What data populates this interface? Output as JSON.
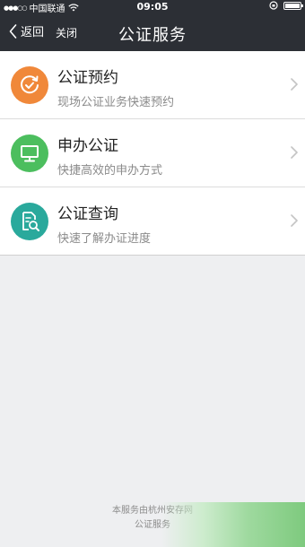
{
  "status": {
    "carrier": "中国联通",
    "time": "09:05"
  },
  "nav": {
    "back_label": "返回",
    "close_label": "关闭",
    "title": "公证服务"
  },
  "menu": [
    {
      "title": "公证预约",
      "subtitle": "现场公证业务快速预约",
      "icon": "clock-check-icon",
      "color": "#f0883a"
    },
    {
      "title": "申办公证",
      "subtitle": "快捷高效的申办方式",
      "icon": "monitor-icon",
      "color": "#4cbe5e"
    },
    {
      "title": "公证查询",
      "subtitle": "快速了解办证进度",
      "icon": "document-search-icon",
      "color": "#2aa99c"
    }
  ],
  "footer": {
    "line1": "本服务由杭州安存网",
    "line2": "公证服务"
  }
}
